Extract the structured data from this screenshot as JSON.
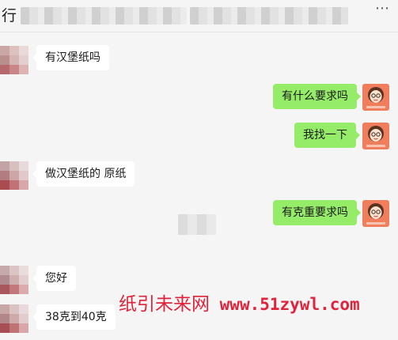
{
  "header": {
    "title": "行",
    "menu_icon": "more-dots-icon"
  },
  "messages": [
    {
      "side": "left",
      "text": "有汉堡纸吗"
    },
    {
      "side": "right",
      "text": "有什么要求吗"
    },
    {
      "side": "right",
      "text": "我找一下"
    },
    {
      "side": "left",
      "text": "做汉堡纸的  原纸"
    },
    {
      "side": "right",
      "text": "有克重要求吗"
    },
    {
      "side": "left",
      "text": "您好"
    },
    {
      "side": "left",
      "text": "38克到40克"
    }
  ],
  "watermark": {
    "brand": "纸引未来网",
    "url": "www.51zywl.com",
    "color": "#e0233b"
  },
  "colors": {
    "background": "#f5f5f5",
    "sent_bubble": "#95ec69",
    "received_bubble": "#ffffff",
    "avatar_accent": "#f07e5c"
  }
}
